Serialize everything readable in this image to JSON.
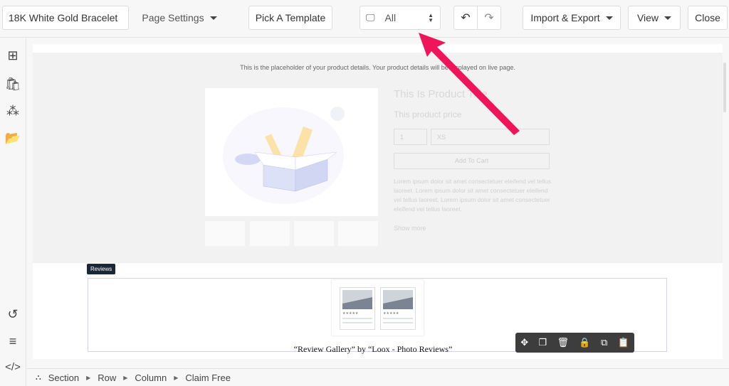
{
  "header": {
    "page_name": "18K White Gold Bracelet",
    "page_settings": "Page Settings",
    "pick_template": "Pick A Template",
    "device": "All",
    "import_export": "Import & Export",
    "view": "View",
    "close": "Close"
  },
  "sidebar": {
    "icons": [
      "add-element-icon",
      "shopify-icon",
      "integrations-icon",
      "folder-icon",
      "history-icon",
      "outline-icon",
      "code-icon"
    ]
  },
  "canvas": {
    "placeholder_note": "This is the placeholder of your product details. Your product details will be displayed on live page.",
    "product_title": "This Is Product Title",
    "product_price": "This product price",
    "quantity": "1",
    "variant": "XS",
    "add_to_cart": "Add To Cart",
    "description": "Lorem ipsum dolor sit amet consectetuer eleifend vel tellus laoreet. Lorem ipsum dolor sit amet consectetuer eleifend vel tellus laoreet. Lorem ipsum dolor sit amet consectetuer eleifend vel tellus laoreet.",
    "show_more": "Show more",
    "reviews_tag": "Reviews",
    "review_caption": "“Review Gallery” by “Loox - Photo Reviews”",
    "stars": "★★★★★"
  },
  "toolbar": {
    "icons": [
      "move-icon",
      "duplicate-icon",
      "delete-icon",
      "lock-icon",
      "copy-style-icon",
      "paste-icon"
    ]
  },
  "breadcrumb": [
    "Section",
    "Row",
    "Column",
    "Claim Free"
  ],
  "colors": {
    "arrow": "#f0145a",
    "toolbar": "#3d3d3d"
  }
}
